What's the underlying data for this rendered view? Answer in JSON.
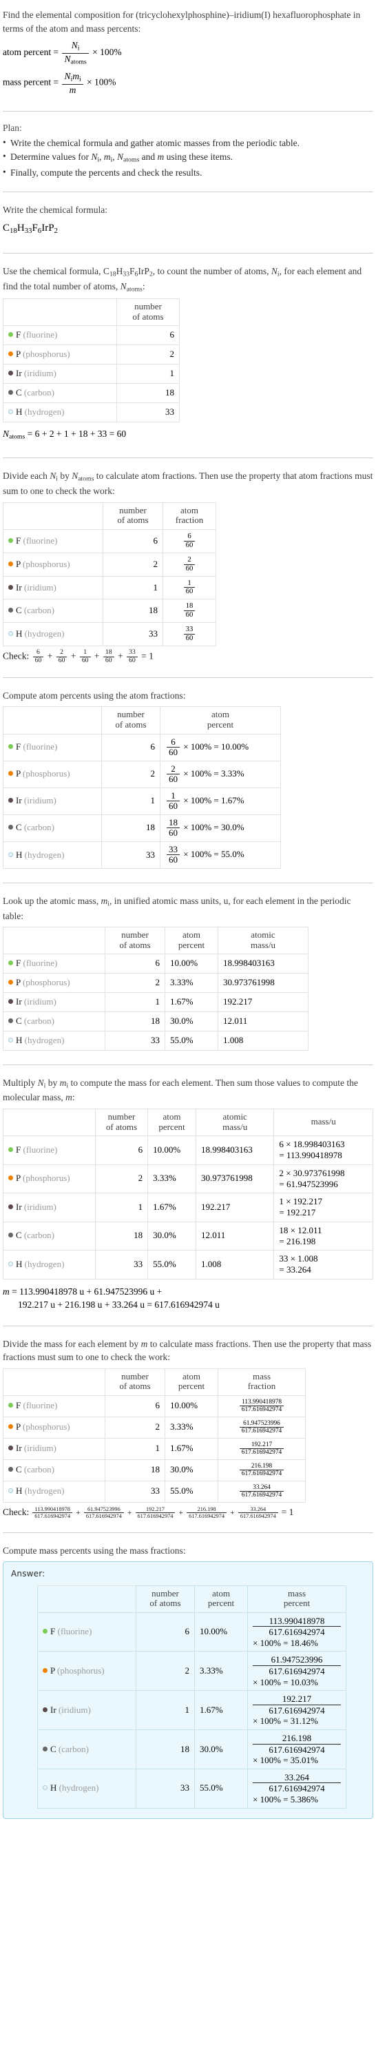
{
  "intro": {
    "question": "Find the elemental composition for (tricyclohexylphosphine)–iridium(I) hexafluorophosphate in terms of the atom and mass percents:",
    "atom_percent_label": "atom percent =",
    "mass_percent_label": "mass percent =",
    "atom_percent_num": "N",
    "atom_percent_num_sub": "i",
    "atom_percent_den": "N",
    "atom_percent_den_sub": "atoms",
    "mass_percent_num": "N",
    "mass_percent_num_sub": "i",
    "mass_percent_num2": "m",
    "mass_percent_num2_sub": "i",
    "mass_percent_den": "m",
    "times_100": "× 100%"
  },
  "plan": {
    "heading": "Plan:",
    "items": [
      "Write the chemical formula and gather atomic masses from the periodic table.",
      "Determine values for Nᵢ, mᵢ, Nₐₜₒₘₛ and m using these items.",
      "Finally, compute the percents and check the results."
    ]
  },
  "formula_step": {
    "prompt": "Write the chemical formula:",
    "formula_plain": "C18H33F6IrP2",
    "formula_parts": [
      {
        "sym": "C",
        "sub": "18"
      },
      {
        "sym": "H",
        "sub": "33"
      },
      {
        "sym": "F",
        "sub": "6"
      },
      {
        "sym": "Ir",
        "sub": ""
      },
      {
        "sym": "P",
        "sub": "2"
      }
    ]
  },
  "count_step": {
    "prompt_a": "Use the chemical formula, ",
    "prompt_b": ", to count the number of atoms, ",
    "prompt_c": ", for each element and find the total number of atoms, ",
    "prompt_d": ":",
    "headers": [
      "",
      "number of atoms"
    ],
    "header_lines": [
      [
        "number",
        "of atoms"
      ]
    ],
    "total_line": "= 6 + 2 + 1 + 18 + 33 = 60",
    "total_symbol": "N",
    "total_symbol_sub": "atoms"
  },
  "elements": [
    {
      "symbol": "F",
      "name": "(fluorine)",
      "color": "#7bcb56",
      "hollow": false,
      "count": "6",
      "atom_fraction_num": "6",
      "atom_fraction_den": "60",
      "atom_percent": "10.00%",
      "atom_percent_expr": "× 100% = 10.00%",
      "atomic_mass": "18.998403163",
      "mass_expr_top": "6 × 18.998403163",
      "mass_expr_bottom": "= 113.990418978",
      "mass": "113.990418978",
      "mass_fraction_num": "113.990418978",
      "mass_fraction_den": "617.616942974",
      "mass_percent_expr": "× 100% = 18.46%",
      "mass_percent": "18.46%"
    },
    {
      "symbol": "P",
      "name": "(phosphorus)",
      "color": "#f08000",
      "hollow": false,
      "count": "2",
      "atom_fraction_num": "2",
      "atom_fraction_den": "60",
      "atom_percent": "3.33%",
      "atom_percent_expr": "× 100% = 3.33%",
      "atomic_mass": "30.973761998",
      "mass_expr_top": "2 × 30.973761998",
      "mass_expr_bottom": "= 61.947523996",
      "mass": "61.947523996",
      "mass_fraction_num": "61.947523996",
      "mass_fraction_den": "617.616942974",
      "mass_percent_expr": "× 100% = 10.03%",
      "mass_percent": "10.03%"
    },
    {
      "symbol": "Ir",
      "name": "(iridium)",
      "color": "#5c4a4a",
      "hollow": false,
      "count": "1",
      "atom_fraction_num": "1",
      "atom_fraction_den": "60",
      "atom_percent": "1.67%",
      "atom_percent_expr": "× 100% = 1.67%",
      "atomic_mass": "192.217",
      "mass_expr_top": "1 × 192.217",
      "mass_expr_bottom": "= 192.217",
      "mass": "192.217",
      "mass_fraction_num": "192.217",
      "mass_fraction_den": "617.616942974",
      "mass_percent_expr": "× 100% = 31.12%",
      "mass_percent": "31.12%"
    },
    {
      "symbol": "C",
      "name": "(carbon)",
      "color": "#646464",
      "hollow": false,
      "count": "18",
      "atom_fraction_num": "18",
      "atom_fraction_den": "60",
      "atom_percent": "30.0%",
      "atom_percent_expr": "× 100% = 30.0%",
      "atomic_mass": "12.011",
      "mass_expr_top": "18 × 12.011",
      "mass_expr_bottom": "= 216.198",
      "mass": "216.198",
      "mass_fraction_num": "216.198",
      "mass_fraction_den": "617.616942974",
      "mass_percent_expr": "× 100% = 35.01%",
      "mass_percent": "35.01%"
    },
    {
      "symbol": "H",
      "name": "(hydrogen)",
      "color": "#e6f6fb",
      "hollow": true,
      "count": "33",
      "atom_fraction_num": "33",
      "atom_fraction_den": "60",
      "atom_percent": "55.0%",
      "atom_percent_expr": "× 100% = 55.0%",
      "atomic_mass": "1.008",
      "mass_expr_top": "33 × 1.008",
      "mass_expr_bottom": "= 33.264",
      "mass": "33.264",
      "mass_fraction_num": "33.264",
      "mass_fraction_den": "617.616942974",
      "mass_percent_expr": "× 100% = 5.386%",
      "mass_percent": "5.386%"
    }
  ],
  "atom_fraction_step": {
    "prompt": "Divide each Nᵢ by Nₐₜₒₘₛ to calculate atom fractions. Then use the property that atom fractions must sum to one to check the work:",
    "h_number": [
      "number",
      "of atoms"
    ],
    "h_fraction": [
      "atom",
      "fraction"
    ],
    "check_label": "Check:",
    "check_result": "= 1"
  },
  "atom_percent_step": {
    "prompt": "Compute atom percents using the atom fractions:",
    "h_number": [
      "number",
      "of atoms"
    ],
    "h_percent": [
      "atom",
      "percent"
    ]
  },
  "atomic_mass_step": {
    "prompt": "Look up the atomic mass, mᵢ, in unified atomic mass units, u, for each element in the periodic table:",
    "h_number": [
      "number",
      "of atoms"
    ],
    "h_percent": [
      "atom",
      "percent"
    ],
    "h_mass": [
      "atomic",
      "mass/u"
    ]
  },
  "molecular_mass_step": {
    "prompt": "Multiply Nᵢ by mᵢ to compute the mass for each element. Then sum those values to compute the molecular mass, m:",
    "h_number": [
      "number",
      "of atoms"
    ],
    "h_percent": [
      "atom",
      "percent"
    ],
    "h_atomic_mass": [
      "atomic",
      "mass/u"
    ],
    "h_mass": [
      "mass/u"
    ],
    "sum_line_1": "= 113.990418978 u + 61.947523996 u +",
    "sum_line_2": "192.217 u + 216.198 u + 33.264 u = 617.616942974 u",
    "sum_symbol": "m"
  },
  "mass_fraction_step": {
    "prompt": "Divide the mass for each element by m to calculate mass fractions. Then use the property that mass fractions must sum to one to check the work:",
    "h_number": [
      "number",
      "of atoms"
    ],
    "h_percent": [
      "atom",
      "percent"
    ],
    "h_fraction": [
      "mass",
      "fraction"
    ],
    "check_label": "Check:",
    "check_result": "= 1"
  },
  "mass_percent_step": {
    "prompt": "Compute mass percents using the mass fractions:",
    "answer_label": "Answer:",
    "h_number": [
      "number",
      "of atoms"
    ],
    "h_percent": [
      "atom",
      "percent"
    ],
    "h_mass_percent": [
      "mass",
      "percent"
    ]
  }
}
